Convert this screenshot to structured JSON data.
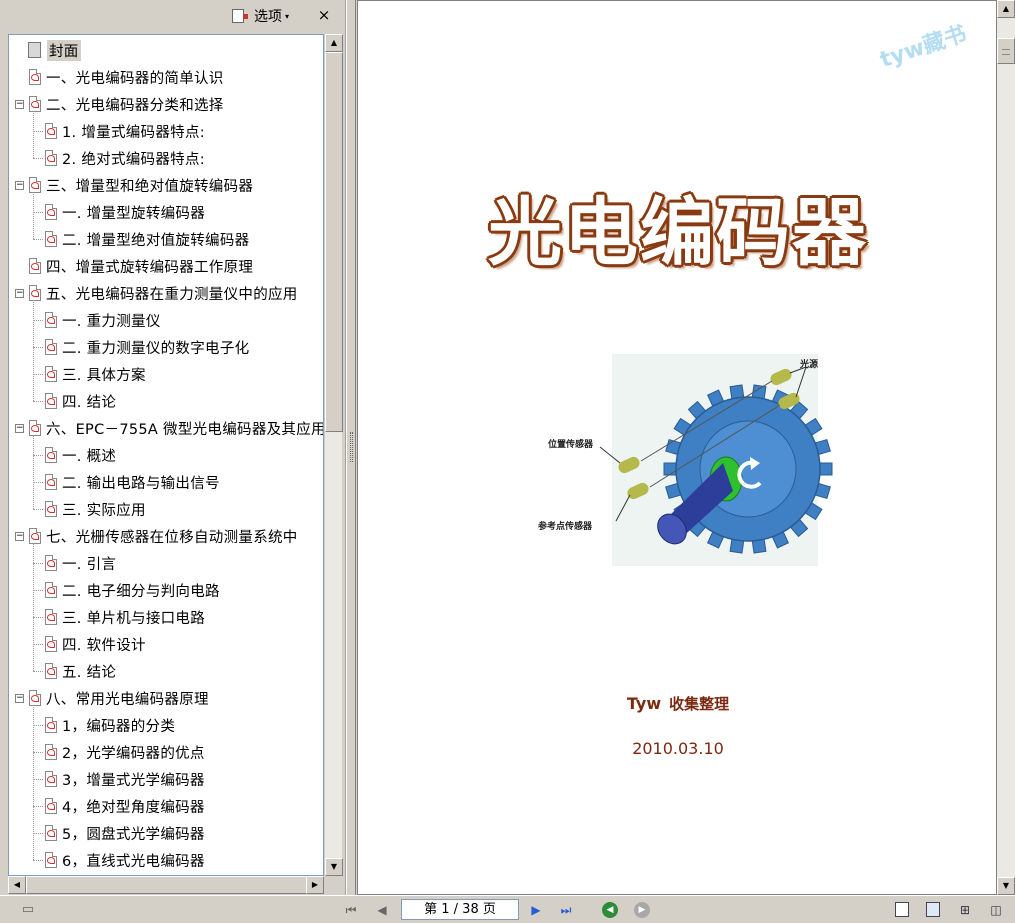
{
  "panel": {
    "options_label": "选项",
    "options_arrow": "▾",
    "close_glyph": "×"
  },
  "bookmarks": [
    {
      "label": "封面",
      "level": 0,
      "icon": "cover-page-icon",
      "toggle": "",
      "selected": true
    },
    {
      "label": "一、光电编码器的简单认识",
      "level": 0,
      "icon": "pdf-bookmark-icon",
      "toggle": ""
    },
    {
      "label": "二、光电编码器分类和选择",
      "level": 0,
      "icon": "pdf-bookmark-icon",
      "toggle": "−"
    },
    {
      "label": "1. 增量式编码器特点:",
      "level": 1,
      "icon": "pdf-bookmark-icon",
      "toggle": ""
    },
    {
      "label": "2. 绝对式编码器特点:",
      "level": 1,
      "icon": "pdf-bookmark-icon",
      "toggle": ""
    },
    {
      "label": "三、增量型和绝对值旋转编码器",
      "level": 0,
      "icon": "pdf-bookmark-icon",
      "toggle": "−"
    },
    {
      "label": "一. 增量型旋转编码器",
      "level": 1,
      "icon": "pdf-bookmark-icon",
      "toggle": ""
    },
    {
      "label": "二. 增量型绝对值旋转编码器",
      "level": 1,
      "icon": "pdf-bookmark-icon",
      "toggle": ""
    },
    {
      "label": "四、增量式旋转编码器工作原理",
      "level": 0,
      "icon": "pdf-bookmark-icon",
      "toggle": ""
    },
    {
      "label": "五、光电编码器在重力测量仪中的应用",
      "level": 0,
      "icon": "pdf-bookmark-icon",
      "toggle": "−"
    },
    {
      "label": "一. 重力测量仪",
      "level": 1,
      "icon": "pdf-bookmark-icon",
      "toggle": ""
    },
    {
      "label": "二. 重力测量仪的数字电子化",
      "level": 1,
      "icon": "pdf-bookmark-icon",
      "toggle": ""
    },
    {
      "label": "三. 具体方案",
      "level": 1,
      "icon": "pdf-bookmark-icon",
      "toggle": ""
    },
    {
      "label": "四. 结论",
      "level": 1,
      "icon": "pdf-bookmark-icon",
      "toggle": ""
    },
    {
      "label": "六、EPC－755A 微型光电编码器及其应用",
      "level": 0,
      "icon": "pdf-bookmark-icon",
      "toggle": "−"
    },
    {
      "label": "一. 概述",
      "level": 1,
      "icon": "pdf-bookmark-icon",
      "toggle": ""
    },
    {
      "label": "二. 输出电路与输出信号",
      "level": 1,
      "icon": "pdf-bookmark-icon",
      "toggle": ""
    },
    {
      "label": "三. 实际应用",
      "level": 1,
      "icon": "pdf-bookmark-icon",
      "toggle": ""
    },
    {
      "label": "七、光栅传感器在位移自动测量系统中",
      "level": 0,
      "icon": "pdf-bookmark-icon",
      "toggle": "−"
    },
    {
      "label": "一. 引言",
      "level": 1,
      "icon": "pdf-bookmark-icon",
      "toggle": ""
    },
    {
      "label": "二. 电子细分与判向电路",
      "level": 1,
      "icon": "pdf-bookmark-icon",
      "toggle": ""
    },
    {
      "label": "三. 单片机与接口电路",
      "level": 1,
      "icon": "pdf-bookmark-icon",
      "toggle": ""
    },
    {
      "label": "四. 软件设计",
      "level": 1,
      "icon": "pdf-bookmark-icon",
      "toggle": ""
    },
    {
      "label": "五. 结论",
      "level": 1,
      "icon": "pdf-bookmark-icon",
      "toggle": ""
    },
    {
      "label": "八、常用光电编码器原理",
      "level": 0,
      "icon": "pdf-bookmark-icon",
      "toggle": "−"
    },
    {
      "label": "1，编码器的分类",
      "level": 1,
      "icon": "pdf-bookmark-icon",
      "toggle": ""
    },
    {
      "label": "2，光学编码器的优点",
      "level": 1,
      "icon": "pdf-bookmark-icon",
      "toggle": ""
    },
    {
      "label": "3，增量式光学编码器",
      "level": 1,
      "icon": "pdf-bookmark-icon",
      "toggle": ""
    },
    {
      "label": "4，绝对型角度编码器",
      "level": 1,
      "icon": "pdf-bookmark-icon",
      "toggle": ""
    },
    {
      "label": "5，圆盘式光学编码器",
      "level": 1,
      "icon": "pdf-bookmark-icon",
      "toggle": ""
    },
    {
      "label": "6，直线式光电编码器",
      "level": 1,
      "icon": "pdf-bookmark-icon",
      "toggle": ""
    }
  ],
  "document": {
    "watermark": "tyw藏书",
    "title": "光电编码器",
    "figure_labels": {
      "light_source": "光源",
      "position_sensor": "位置传感器",
      "reference_sensor": "参考点传感器"
    },
    "author_name": "Tyw",
    "author_suffix": "收集整理",
    "date": "2010.03.10"
  },
  "statusbar": {
    "page_indicator": "第 1 / 38 页"
  },
  "colors": {
    "title_outline": "#8a3a10",
    "author_text": "#7a2a10",
    "gear": "#3f7fc4",
    "shaft": "#2c3e9a",
    "collar": "#2ec02e",
    "sensor": "#b5b84a",
    "nav_green": "#2e8b3a"
  }
}
